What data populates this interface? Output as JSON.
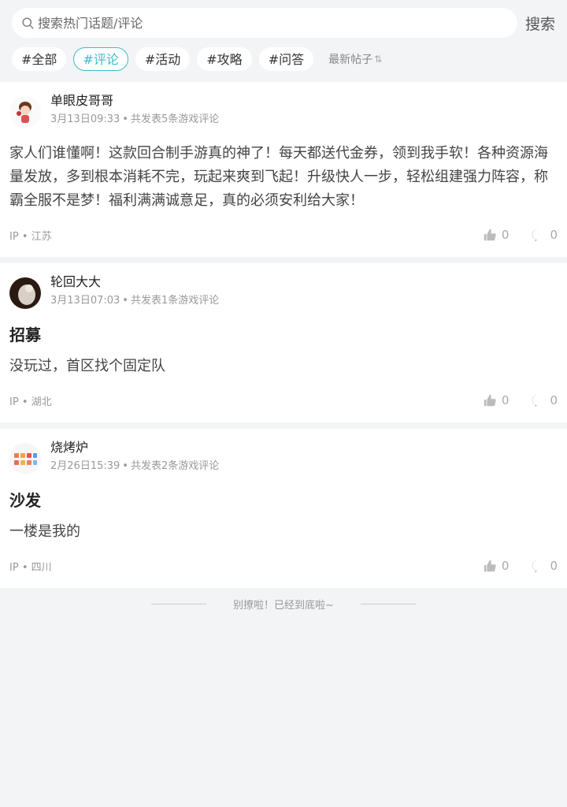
{
  "search": {
    "placeholder": "搜索热门话题/评论",
    "button_label": "搜索"
  },
  "tags": [
    {
      "label": "#全部",
      "active": false
    },
    {
      "label": "#评论",
      "active": true
    },
    {
      "label": "#活动",
      "active": false
    },
    {
      "label": "#攻略",
      "active": false
    },
    {
      "label": "#问答",
      "active": false
    }
  ],
  "sort": {
    "label": "最新帖子",
    "icon": "sort-arrows-icon"
  },
  "posts": [
    {
      "username": "单眼皮哥哥",
      "time": "3月13日09:33",
      "count_text": "共发表5条游戏评论",
      "title": "",
      "body": "家人们谁懂啊！这款回合制手游真的神了！每天都送代金券，领到我手软！各种资源海量发放，多到根本消耗不完，玩起来爽到飞起！升级快人一步，轻松组建强力阵容，称霸全服不是梦！福利满满诚意足，真的必须安利给大家！",
      "ip_label": "IP",
      "ip_location": "江苏",
      "likes": "0",
      "comments": "0"
    },
    {
      "username": "轮回大大",
      "time": "3月13日07:03",
      "count_text": "共发表1条游戏评论",
      "title": "招募",
      "body": "没玩过，首区找个固定队",
      "ip_label": "IP",
      "ip_location": "湖北",
      "likes": "0",
      "comments": "0"
    },
    {
      "username": "烧烤炉",
      "time": "2月26日15:39",
      "count_text": "共发表2条游戏评论",
      "title": "沙发",
      "body": "一楼是我的",
      "ip_label": "IP",
      "ip_location": "四川",
      "likes": "0",
      "comments": "0"
    }
  ],
  "end_text": "别撩啦！已经到底啦~",
  "colors": {
    "accent": "#3dbcc8",
    "background": "#f3f4f6"
  }
}
